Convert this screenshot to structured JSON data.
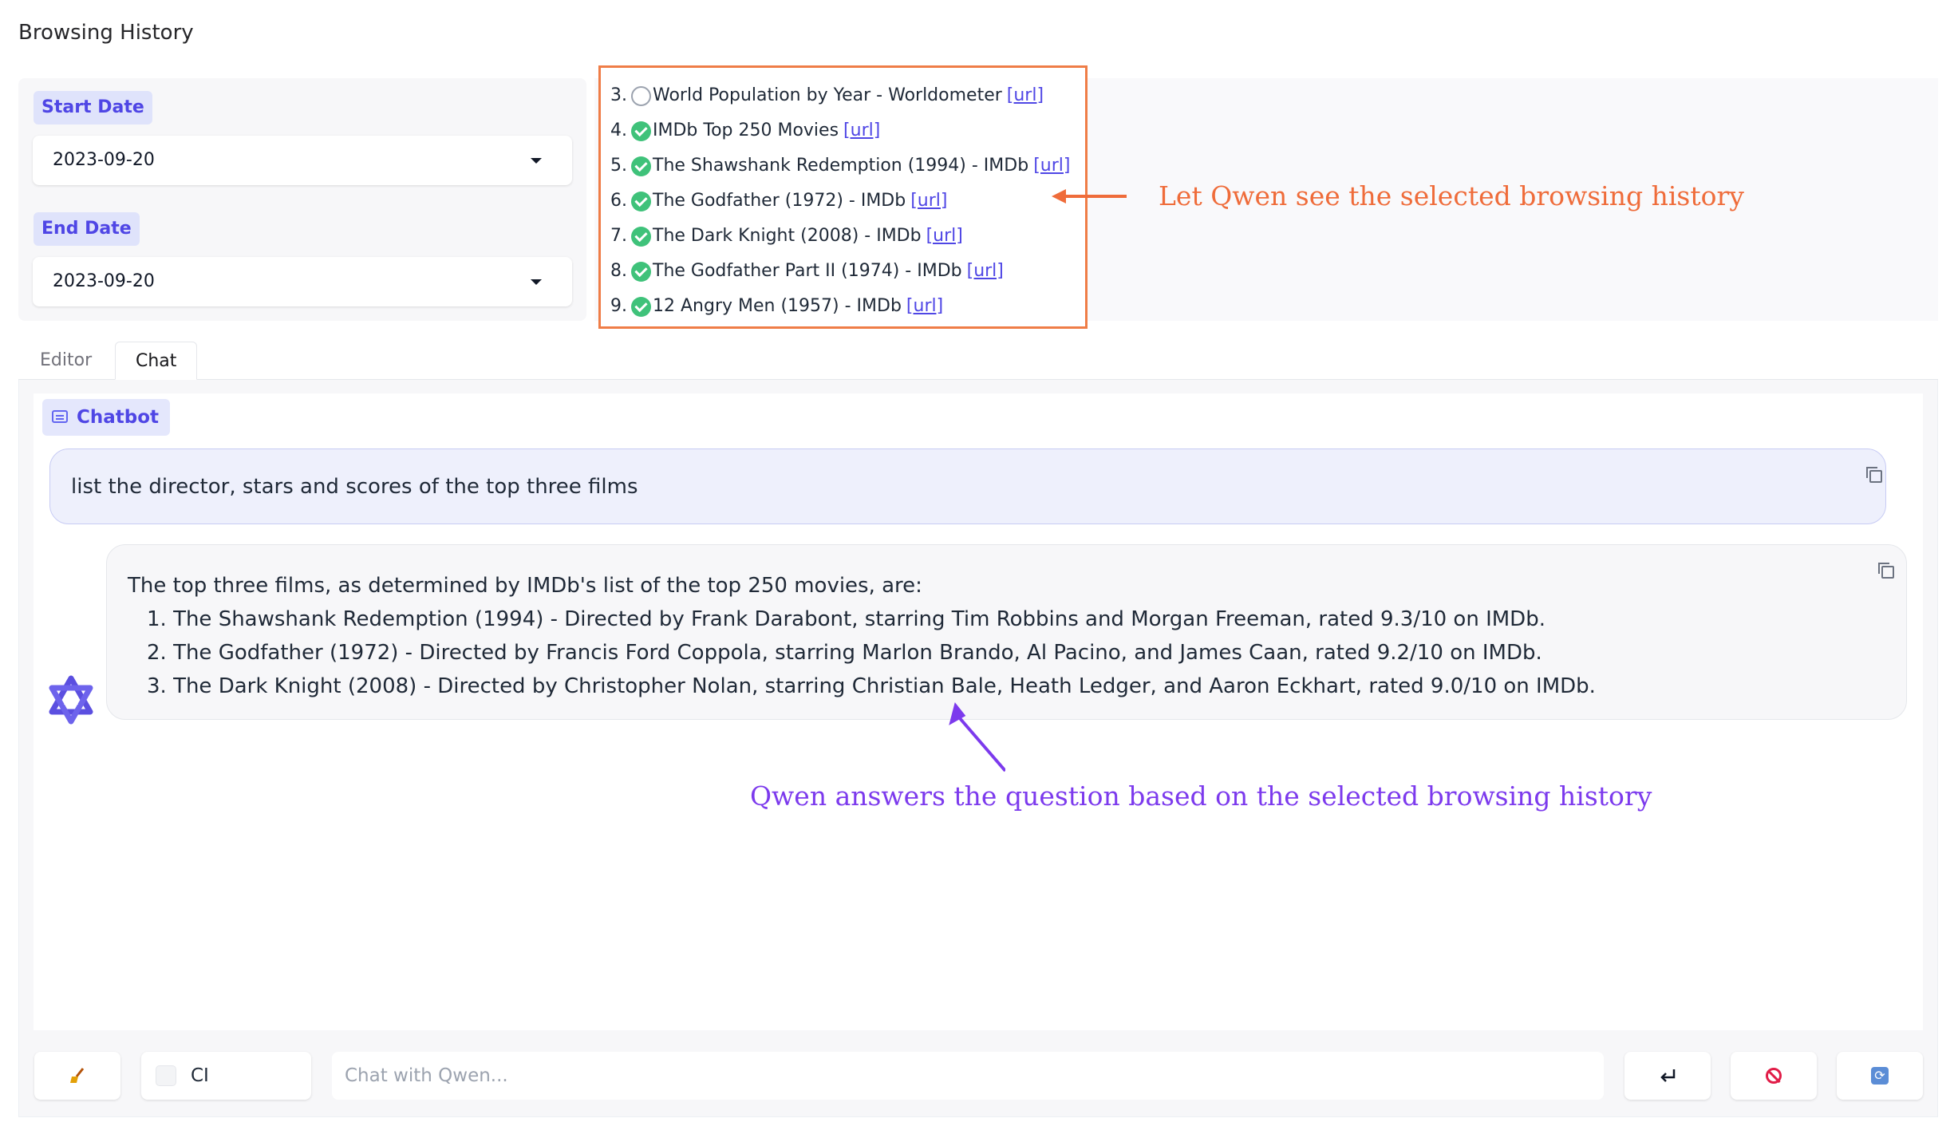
{
  "page": {
    "title": "Browsing History"
  },
  "dates": {
    "start_label": "Start Date",
    "start_value": "2023-09-20",
    "end_label": "End Date",
    "end_value": "2023-09-20"
  },
  "history": {
    "items": [
      {
        "num": "3.",
        "title": "World Population by Year - Worldometer",
        "link": "[url]",
        "checked": false
      },
      {
        "num": "4.",
        "title": "IMDb Top 250 Movies",
        "link": "[url]",
        "checked": true
      },
      {
        "num": "5.",
        "title": "The Shawshank Redemption (1994) - IMDb",
        "link": "[url]",
        "checked": true
      },
      {
        "num": "6.",
        "title": "The Godfather (1972) - IMDb",
        "link": "[url]",
        "checked": true
      },
      {
        "num": "7.",
        "title": "The Dark Knight (2008) - IMDb",
        "link": "[url]",
        "checked": true
      },
      {
        "num": "8.",
        "title": "The Godfather Part II (1974) - IMDb",
        "link": "[url]",
        "checked": true
      },
      {
        "num": "9.",
        "title": "12 Angry Men (1957) - IMDb",
        "link": "[url]",
        "checked": true
      }
    ]
  },
  "annotations": {
    "top": "Let Qwen see the selected browsing history",
    "bottom": "Qwen answers the question based on the selected browsing history",
    "top_color": "#ef6c3a",
    "bottom_color": "#7c3aed"
  },
  "tabs": [
    {
      "label": "Editor",
      "active": false
    },
    {
      "label": "Chat",
      "active": true
    }
  ],
  "chatbot": {
    "label": "Chatbot",
    "user_message": "list the director, stars and scores of the top three films",
    "bot_intro": "The top three films, as determined by IMDb's list of the top 250 movies, are:",
    "bot_items": [
      "1. The Shawshank Redemption (1994) - Directed by Frank Darabont, starring Tim Robbins and Morgan Freeman, rated 9.3/10 on IMDb.",
      "2. The Godfather (1972) - Directed by Francis Ford Coppola, starring Marlon Brando, Al Pacino, and James Caan, rated 9.2/10 on IMDb.",
      "3. The Dark Knight (2008) - Directed by Christopher Nolan, starring Christian Bale, Heath Ledger, and Aaron Eckhart, rated 9.0/10 on IMDb."
    ]
  },
  "input_bar": {
    "ci_label": "CI",
    "placeholder": "Chat with Qwen...",
    "icons": [
      "broom-icon",
      "enter-icon",
      "stop-icon",
      "regenerate-icon"
    ]
  },
  "colors": {
    "accent": "#4f46e5",
    "check": "#3fc27a",
    "highlight_border": "#ef7d47"
  }
}
